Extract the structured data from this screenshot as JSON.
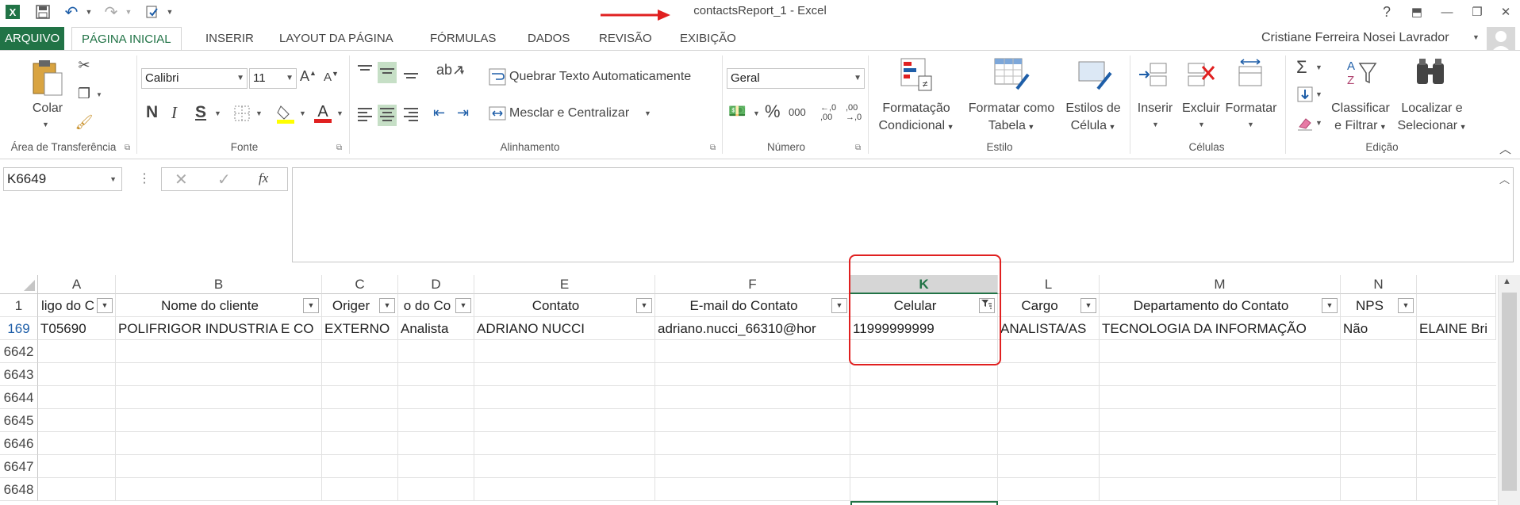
{
  "app": {
    "title": "contactsReport_1 - Excel"
  },
  "window_buttons": {
    "help": "?",
    "restore_ribbon": "⬒",
    "minimize": "—",
    "maximize": "❐",
    "close": "✕"
  },
  "tabs": [
    "ARQUIVO",
    "PÁGINA INICIAL",
    "INSERIR",
    "LAYOUT DA PÁGINA",
    "FÓRMULAS",
    "DADOS",
    "REVISÃO",
    "EXIBIÇÃO"
  ],
  "user": {
    "name": "Cristiane Ferreira Nosei Lavrador"
  },
  "ribbon": {
    "clipboard": {
      "paste": "Colar",
      "label": "Área de Transferência"
    },
    "font": {
      "name": "Calibri",
      "size": "11",
      "bold": "N",
      "italic": "I",
      "underline": "S",
      "label": "Fonte"
    },
    "alignment": {
      "wrap": "Quebrar Texto Automaticamente",
      "merge": "Mesclar e Centralizar",
      "label": "Alinhamento"
    },
    "number": {
      "format": "Geral",
      "percent": "%",
      "thousands": "000",
      "label": "Número"
    },
    "styles": {
      "conditional_1": "Formatação",
      "conditional_2": "Condicional",
      "table_1": "Formatar como",
      "table_2": "Tabela",
      "cell_1": "Estilos de",
      "cell_2": "Célula",
      "label": "Estilo"
    },
    "cells": {
      "insert": "Inserir",
      "delete": "Excluir",
      "format": "Formatar",
      "label": "Células"
    },
    "editing": {
      "sort_1": "Classificar",
      "sort_2": "e Filtrar",
      "find_1": "Localizar e",
      "find_2": "Selecionar",
      "label": "Edição"
    }
  },
  "formula_bar": {
    "name_box": "K6649",
    "fx": "fx",
    "value": ""
  },
  "columns": [
    "A",
    "B",
    "C",
    "D",
    "E",
    "F",
    "K",
    "L",
    "M",
    "N"
  ],
  "header_row": {
    "row_number": "1",
    "cells": [
      "ligo do C",
      "Nome do cliente",
      "Origer",
      "o do Co",
      "Contato",
      "E-mail do Contato",
      "Celular",
      "Cargo",
      "Departamento do Contato",
      "NPS"
    ]
  },
  "data_rows": [
    {
      "row": "169",
      "cells": [
        "T05690",
        "POLIFRIGOR INDUSTRIA E CO",
        "EXTERNO",
        "Analista",
        "ADRIANO NUCCI",
        "adriano.nucci_66310@hor",
        "11999999999",
        "ANALISTA/AS",
        "TECNOLOGIA DA INFORMAÇÃO",
        "Não",
        "ELAINE Bri"
      ]
    }
  ],
  "empty_rows": [
    "6642",
    "6643",
    "6644",
    "6645",
    "6646",
    "6647",
    "6648"
  ],
  "colors": {
    "excel_green": "#217346",
    "annotation_red": "#e02020"
  }
}
